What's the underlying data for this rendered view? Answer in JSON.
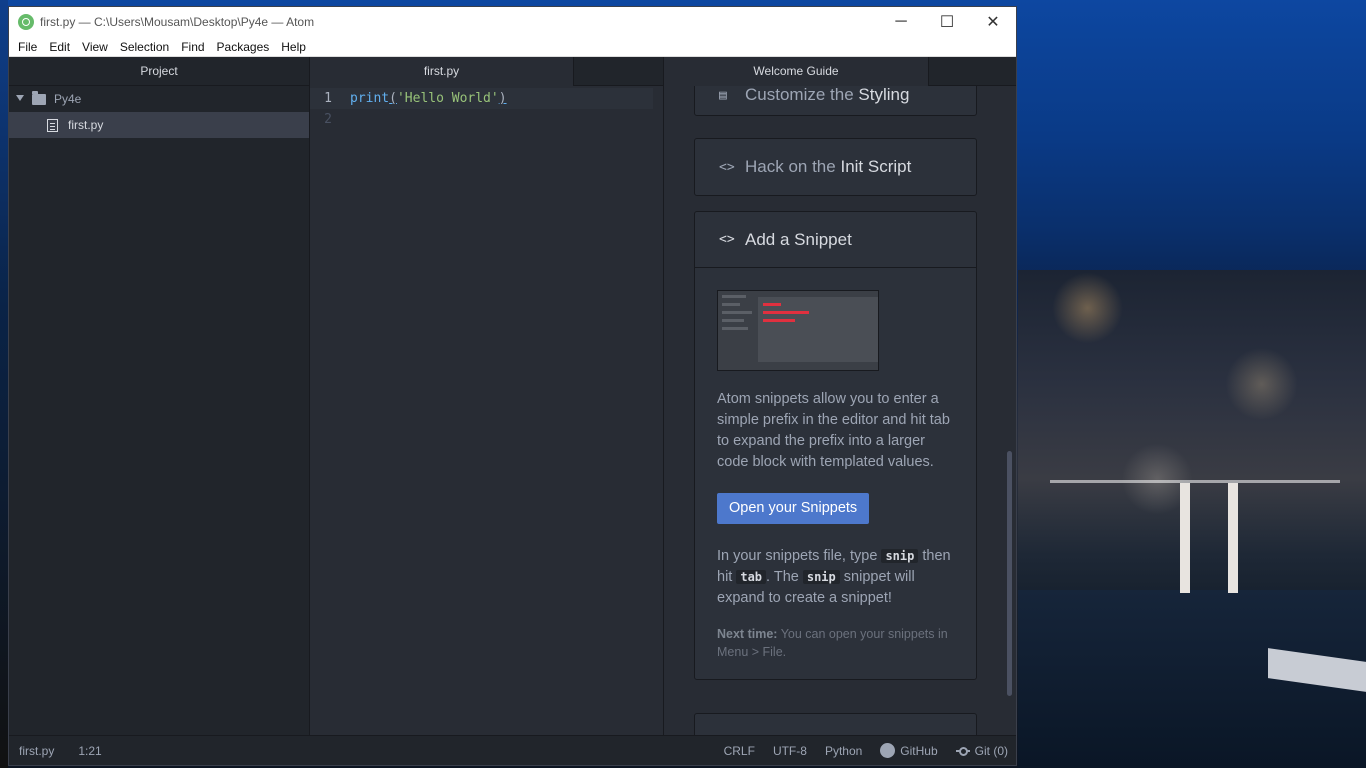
{
  "window": {
    "title": "first.py — C:\\Users\\Mousam\\Desktop\\Py4e — Atom",
    "controls": {
      "minimize": "─",
      "maximize": "☐",
      "close": "✕"
    }
  },
  "menu": [
    "File",
    "Edit",
    "View",
    "Selection",
    "Find",
    "Packages",
    "Help"
  ],
  "tree": {
    "header": "Project",
    "folder": "Py4e",
    "file": "first.py"
  },
  "editor": {
    "tab": "first.py",
    "lines": [
      {
        "number": "1",
        "fn": "print",
        "open": "(",
        "str": "'Hello World'",
        "close": ")"
      },
      {
        "number": "2"
      }
    ]
  },
  "guide": {
    "tab": "Welcome Guide",
    "cards": [
      {
        "icon": "paint-bucket-icon",
        "prefix": "Customize the",
        "strong": "Styling"
      },
      {
        "icon": "code-icon",
        "prefix": "Hack on the",
        "strong": "Init Script"
      },
      {
        "icon": "code-icon",
        "title": "Add a Snippet"
      }
    ],
    "snippet": {
      "description": "Atom snippets allow you to enter a simple prefix in the editor and hit tab to expand the prefix into a larger code block with templated values.",
      "button": "Open your Snippets",
      "instr_1": "In your snippets file, type",
      "code_snip": "snip",
      "instr_2": "then hit",
      "code_tab": "tab",
      "instr_3": ". The",
      "instr_4": "snippet will expand to create a snippet!",
      "next_label": "Next time:",
      "next_text": "You can open your snippets in Menu > File."
    }
  },
  "status": {
    "file": "first.py",
    "cursor": "1:21",
    "line_ending": "CRLF",
    "encoding": "UTF-8",
    "grammar": "Python",
    "github": "GitHub",
    "git": "Git (0)"
  },
  "colors": {
    "accent": "#4d78cc",
    "editor_bg": "#282c34",
    "panel_bg": "#21252b",
    "string": "#98c379",
    "function": "#61afef"
  }
}
